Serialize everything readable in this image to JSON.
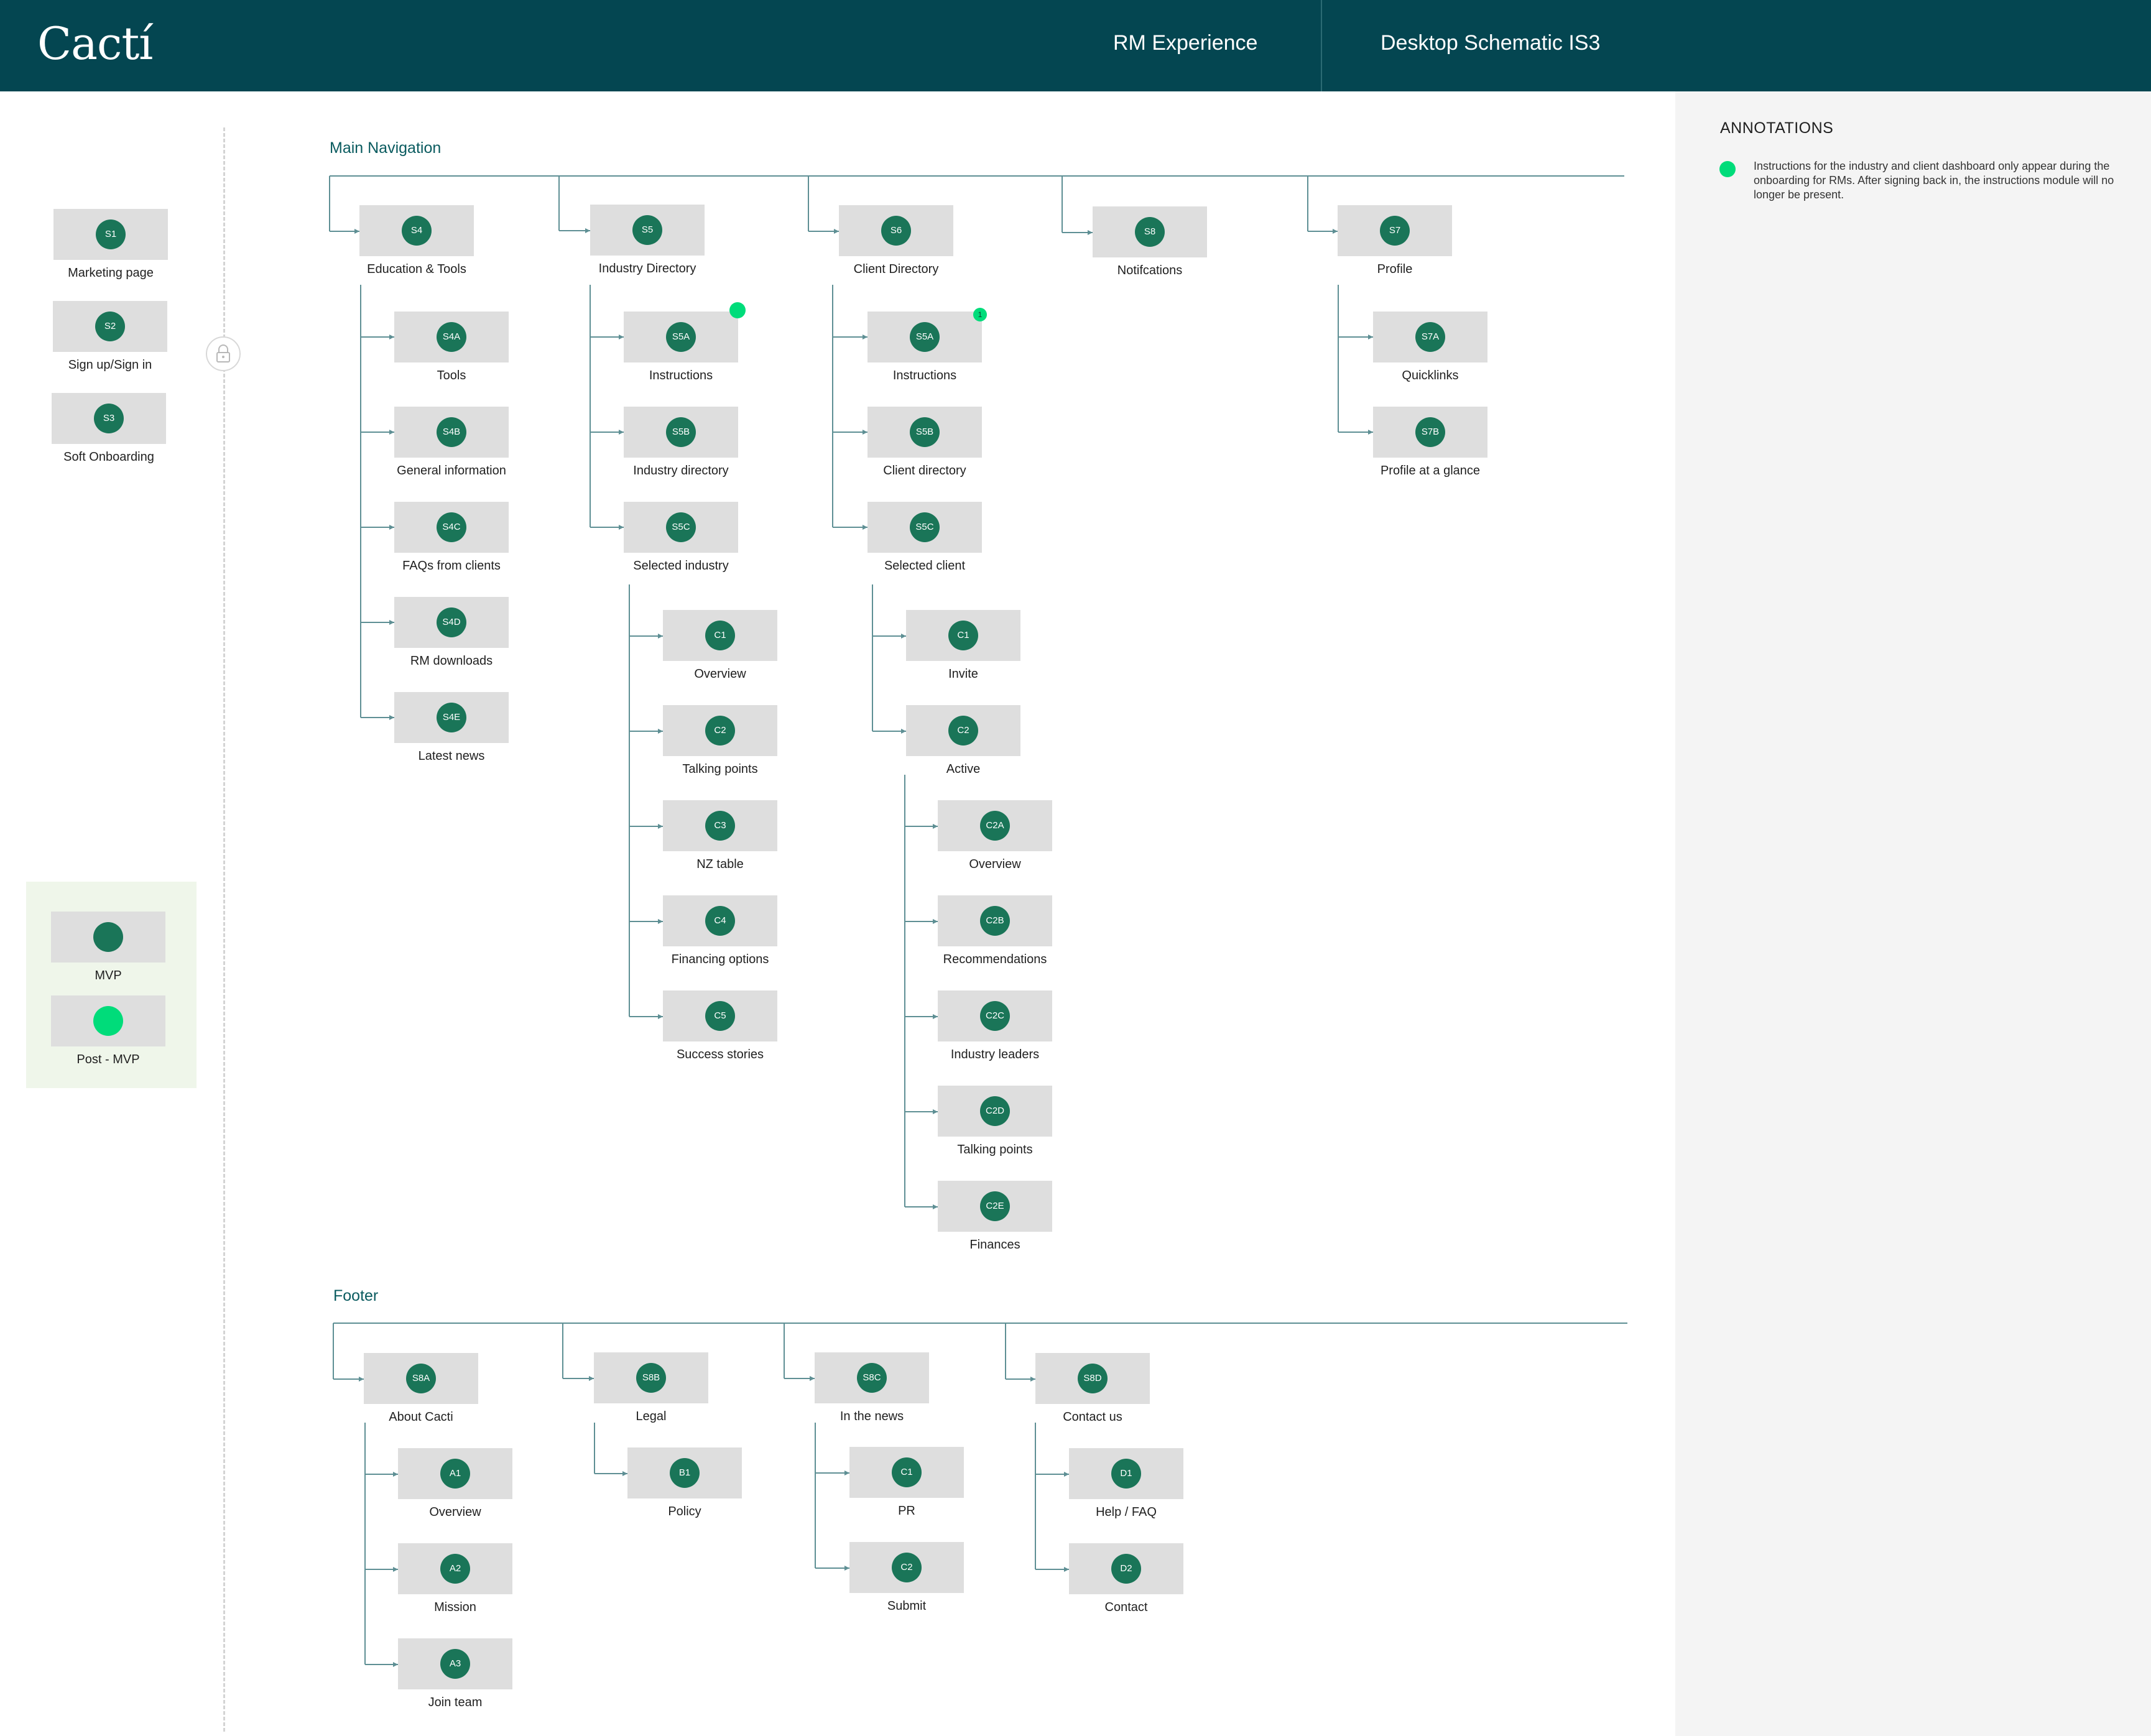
{
  "header": {
    "logo": "Cactí",
    "project": "RM Experience",
    "title": "Desktop Schematic IS3"
  },
  "annotations": {
    "title": "ANNOTATIONS",
    "note": "Instructions for the industry and client dashboard only appear during the onboarding for RMs. After signing back in, the instructions module will no longer be present."
  },
  "colors": {
    "header_bg": "#044651",
    "mvp": "#1a7558",
    "post_mvp": "#00dc7a",
    "card": "#dedede",
    "connector": "#5e8f94",
    "legend_bg": "#eff6ea"
  },
  "entry_screens": [
    {
      "code": "S1",
      "label": "Marketing page"
    },
    {
      "code": "S2",
      "label": "Sign up/Sign in"
    },
    {
      "code": "S3",
      "label": "Soft Onboarding"
    }
  ],
  "legend": [
    {
      "label": "MVP",
      "color": "#1a7558"
    },
    {
      "label": "Post - MVP",
      "color": "#00dc7a"
    }
  ],
  "main_nav": {
    "title": "Main Navigation",
    "nodes": [
      {
        "code": "S4",
        "label": "Education & Tools"
      },
      {
        "code": "S4A",
        "label": "Tools"
      },
      {
        "code": "S4B",
        "label": "General information"
      },
      {
        "code": "S4C",
        "label": "FAQs from clients"
      },
      {
        "code": "S4D",
        "label": "RM downloads"
      },
      {
        "code": "S4E",
        "label": "Latest news"
      },
      {
        "code": "S5",
        "label": "Industry Directory"
      },
      {
        "code": "S5A",
        "label": "Instructions"
      },
      {
        "code": "S5B",
        "label": "Industry directory"
      },
      {
        "code": "S5C",
        "label": "Selected industry"
      },
      {
        "code": "C1",
        "label": "Overview"
      },
      {
        "code": "C2",
        "label": "Talking points"
      },
      {
        "code": "C3",
        "label": "NZ table"
      },
      {
        "code": "C4",
        "label": "Financing options"
      },
      {
        "code": "C5",
        "label": "Success stories"
      },
      {
        "code": "S6",
        "label": "Client Directory"
      },
      {
        "code": "S5A",
        "label": "Instructions",
        "flag": "1"
      },
      {
        "code": "S5B",
        "label": "Client directory"
      },
      {
        "code": "S5C",
        "label": "Selected client"
      },
      {
        "code": "C1",
        "label": "Invite"
      },
      {
        "code": "C2",
        "label": "Active"
      },
      {
        "code": "C2A",
        "label": "Overview"
      },
      {
        "code": "C2B",
        "label": "Recommendations"
      },
      {
        "code": "C2C",
        "label": "Industry leaders"
      },
      {
        "code": "C2D",
        "label": "Talking points"
      },
      {
        "code": "C2E",
        "label": "Finances"
      },
      {
        "code": "S8",
        "label": "Notifcations"
      },
      {
        "code": "S7",
        "label": "Profile"
      },
      {
        "code": "S7A",
        "label": "Quicklinks"
      },
      {
        "code": "S7B",
        "label": "Profile at a glance"
      }
    ]
  },
  "footer": {
    "title": "Footer",
    "nodes": [
      {
        "code": "S8A",
        "label": "About Cacti"
      },
      {
        "code": "A1",
        "label": "Overview"
      },
      {
        "code": "A2",
        "label": "Mission"
      },
      {
        "code": "A3",
        "label": "Join team"
      },
      {
        "code": "S8B",
        "label": "Legal"
      },
      {
        "code": "B1",
        "label": "Policy"
      },
      {
        "code": "S8C",
        "label": "In the news"
      },
      {
        "code": "C1",
        "label": "PR"
      },
      {
        "code": "C2",
        "label": "Submit"
      },
      {
        "code": "S8D",
        "label": "Contact us"
      },
      {
        "code": "D1",
        "label": "Help / FAQ"
      },
      {
        "code": "D2",
        "label": "Contact"
      }
    ]
  }
}
